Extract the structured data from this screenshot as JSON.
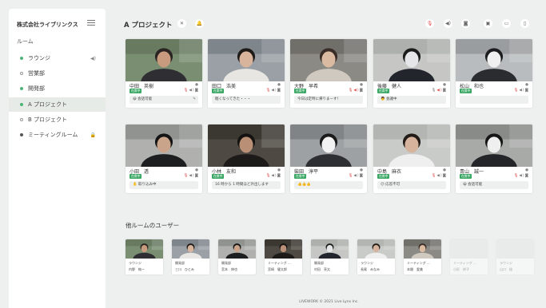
{
  "sidebar": {
    "company": "株式会社ライブリンクス",
    "rooms_title": "ルーム",
    "rooms": [
      {
        "label": "ラウンジ",
        "dot": "green",
        "icon": "speaker-icon",
        "glyph": "◀)"
      },
      {
        "label": "営業部",
        "dot": "hollow",
        "icon": "",
        "glyph": ""
      },
      {
        "label": "開発部",
        "dot": "green",
        "icon": "",
        "glyph": ""
      },
      {
        "label": "A プロジェクト",
        "dot": "green",
        "icon": "",
        "glyph": "",
        "active": true
      },
      {
        "label": "B プロジェクト",
        "dot": "hollow",
        "icon": "",
        "glyph": ""
      },
      {
        "label": "ミーティングルーム",
        "dot": "dark",
        "icon": "lock-icon",
        "glyph": "🔒"
      }
    ]
  },
  "main": {
    "title": "A プロジェクト"
  },
  "members": [
    {
      "name": "中田　英樹",
      "badge": "在席中",
      "status": "😀 会話可能",
      "editable": true
    },
    {
      "name": "田口　浩美",
      "badge": "在席中",
      "status": "眠くなってきた・・・"
    },
    {
      "name": "大野　早希",
      "badge": "在席中",
      "status": "今日は定時に帰りまーす！"
    },
    {
      "name": "後藤　健人",
      "badge": "在席中",
      "status": "👨 会議中"
    },
    {
      "name": "松山　和也",
      "badge": "在席中",
      "status": ""
    },
    {
      "name": "小田　透",
      "badge": "在席中",
      "status": "✋ 取り込み中"
    },
    {
      "name": "小林　友和",
      "badge": "在席中",
      "status": "16 時から 1 時間ほど外出します"
    },
    {
      "name": "柴田　淳平",
      "badge": "在席中",
      "status": "👍👍👍"
    },
    {
      "name": "中島　麻衣",
      "badge": "在席中",
      "status": "😕 応答不可"
    },
    {
      "name": "青山　誠一",
      "badge": "在席中",
      "status": "😀 会話可能"
    }
  ],
  "others": {
    "title": "他ルームのユーザー",
    "users": [
      {
        "room": "ラウンジ",
        "name": "内野　純一",
        "dim": false
      },
      {
        "room": "開発部",
        "name": "三川　ひとみ",
        "dim": false
      },
      {
        "room": "開発部",
        "name": "宮本　伸也",
        "dim": false
      },
      {
        "room": "ミーティング ...",
        "name": "宮崎　健太郎",
        "dim": false
      },
      {
        "room": "開発部",
        "name": "村田　亮太",
        "dim": false
      },
      {
        "room": "ラウンジ",
        "name": "長尾　みなみ",
        "dim": false
      },
      {
        "room": "ミーティング ...",
        "name": "本間　愛美",
        "dim": false
      },
      {
        "room": "ミーティング ...",
        "name": "小形　祥子",
        "dim": true
      },
      {
        "room": "ラウンジ",
        "name": "山口　稔",
        "dim": true
      }
    ]
  },
  "footer": "LIVEWORK © 2021 Live Lynx Inc."
}
